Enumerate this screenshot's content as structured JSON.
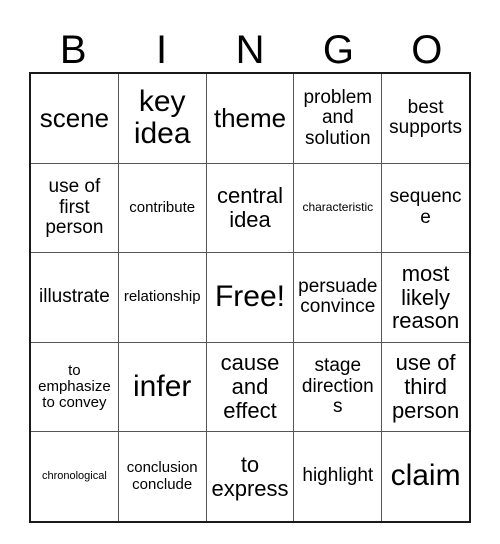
{
  "card": {
    "title": "BINGO",
    "header_letters": [
      "B",
      "I",
      "N",
      "G",
      "O"
    ],
    "free_space_label": "Free!",
    "colors": {
      "grid_border": "#1a1a1a",
      "cell_divider": "#555555",
      "text": "#000000",
      "background": "#ffffff"
    },
    "rows": [
      [
        {
          "text": "scene",
          "size": "lg"
        },
        {
          "text": "key\nidea",
          "size": "xl"
        },
        {
          "text": "theme",
          "size": "lg"
        },
        {
          "text": "problem\nand\nsolution",
          "size": "sm"
        },
        {
          "text": "best\nsupports",
          "size": "sm"
        }
      ],
      [
        {
          "text": "use of\nfirst\nperson",
          "size": "sm"
        },
        {
          "text": "contribute",
          "size": "xs"
        },
        {
          "text": "central\nidea",
          "size": "md"
        },
        {
          "text": "characteristic",
          "size": "xxs"
        },
        {
          "text": "sequence",
          "size": "sm"
        }
      ],
      [
        {
          "text": "illustrate",
          "size": "sm"
        },
        {
          "text": "relationship",
          "size": "xs"
        },
        {
          "text": "Free!",
          "size": "xl"
        },
        {
          "text": "persuade\nconvince",
          "size": "sm"
        },
        {
          "text": "most\nlikely\nreason",
          "size": "md"
        }
      ],
      [
        {
          "text": "to\nemphasize\nto convey",
          "size": "xs"
        },
        {
          "text": "infer",
          "size": "xl"
        },
        {
          "text": "cause\nand\neffect",
          "size": "md"
        },
        {
          "text": "stage\ndirections",
          "size": "sm"
        },
        {
          "text": "use of\nthird\nperson",
          "size": "md"
        }
      ],
      [
        {
          "text": "chronological",
          "size": "xxxs"
        },
        {
          "text": "conclusion\nconclude",
          "size": "xs"
        },
        {
          "text": "to\nexpress",
          "size": "md"
        },
        {
          "text": "highlight",
          "size": "sm"
        },
        {
          "text": "claim",
          "size": "xl"
        }
      ]
    ]
  }
}
